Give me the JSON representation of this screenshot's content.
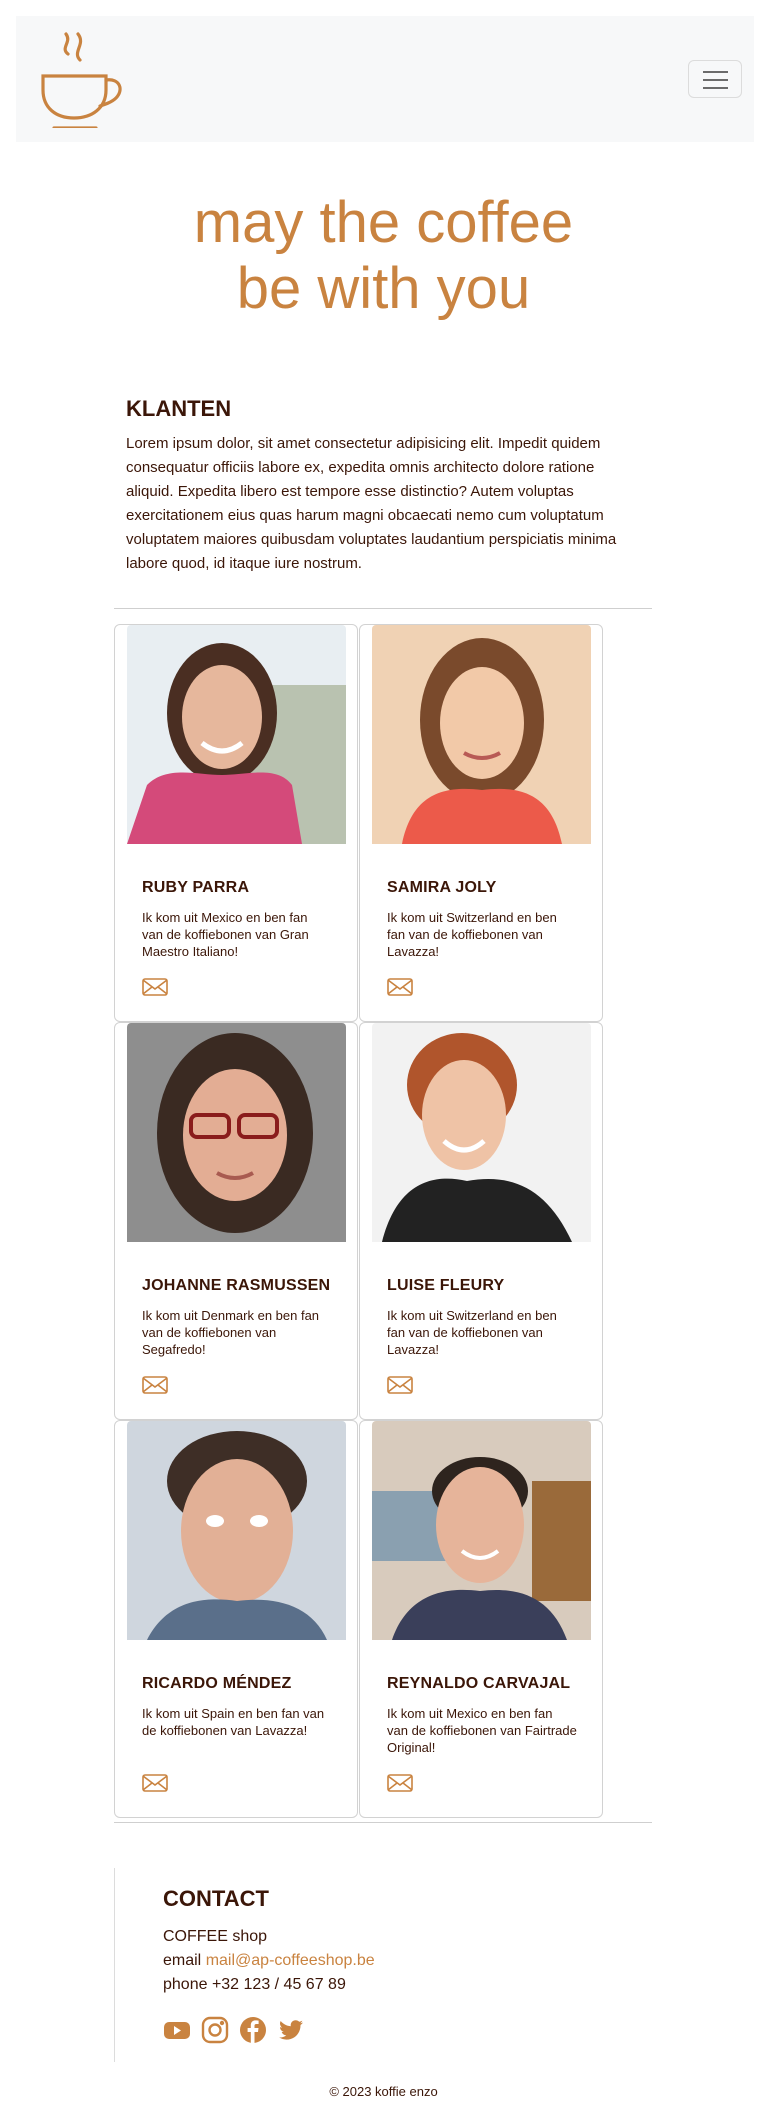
{
  "colors": {
    "accent": "#c98340",
    "text": "#3b1608",
    "navbar_bg": "#f7f8f9"
  },
  "navbar": {
    "logo_icon": "coffee-cup-icon",
    "toggler_icon": "hamburger-icon"
  },
  "hero": {
    "line1": "may the coffee",
    "line2": "be with you"
  },
  "intro": {
    "title": "KLANTEN",
    "text": "Lorem ipsum dolor, sit amet consectetur adipisicing elit. Impedit quidem consequatur officiis labore ex, expedita omnis architecto dolore ratione aliquid. Expedita libero est tempore esse distinctio? Autem voluptas exercitationem eius quas harum magni obcaecati nemo cum voluptatum voluptatem maiores quibusdam voluptates laudantium perspiciatis minima labore quod, id itaque iure nostrum."
  },
  "cards": [
    {
      "name": "RUBY PARRA",
      "text": "Ik kom uit Mexico en ben fan van de koffiebonen van Gran Maestro Italiano!",
      "icon": "mail-icon"
    },
    {
      "name": "SAMIRA JOLY",
      "text": "Ik kom uit Switzerland en ben fan van de koffiebonen van Lavazza!",
      "icon": "mail-icon"
    },
    {
      "name": "JOHANNE RASMUSSEN",
      "text": "Ik kom uit Denmark en ben fan van de koffiebonen van Segafredo!",
      "icon": "mail-icon"
    },
    {
      "name": "LUISE FLEURY",
      "text": "Ik kom uit Switzerland en ben fan van de koffiebonen van Lavazza!",
      "icon": "mail-icon"
    },
    {
      "name": "RICARDO MÉNDEZ",
      "text": "Ik kom uit Spain en ben fan van de koffiebonen van Lavazza!",
      "icon": "mail-icon"
    },
    {
      "name": "REYNALDO CARVAJAL",
      "text": "Ik kom uit Mexico en ben fan van de koffiebonen van Fairtrade Original!",
      "icon": "mail-icon"
    }
  ],
  "contact": {
    "title": "CONTACT",
    "shop": "COFFEE shop",
    "email_label": "email",
    "email": "mail@ap-coffeeshop.be",
    "phone": "phone +32 123 / 45 67 89",
    "social": [
      "youtube-icon",
      "instagram-icon",
      "facebook-icon",
      "twitter-icon"
    ]
  },
  "footer": {
    "copyright": "© 2023 koffie enzo"
  }
}
